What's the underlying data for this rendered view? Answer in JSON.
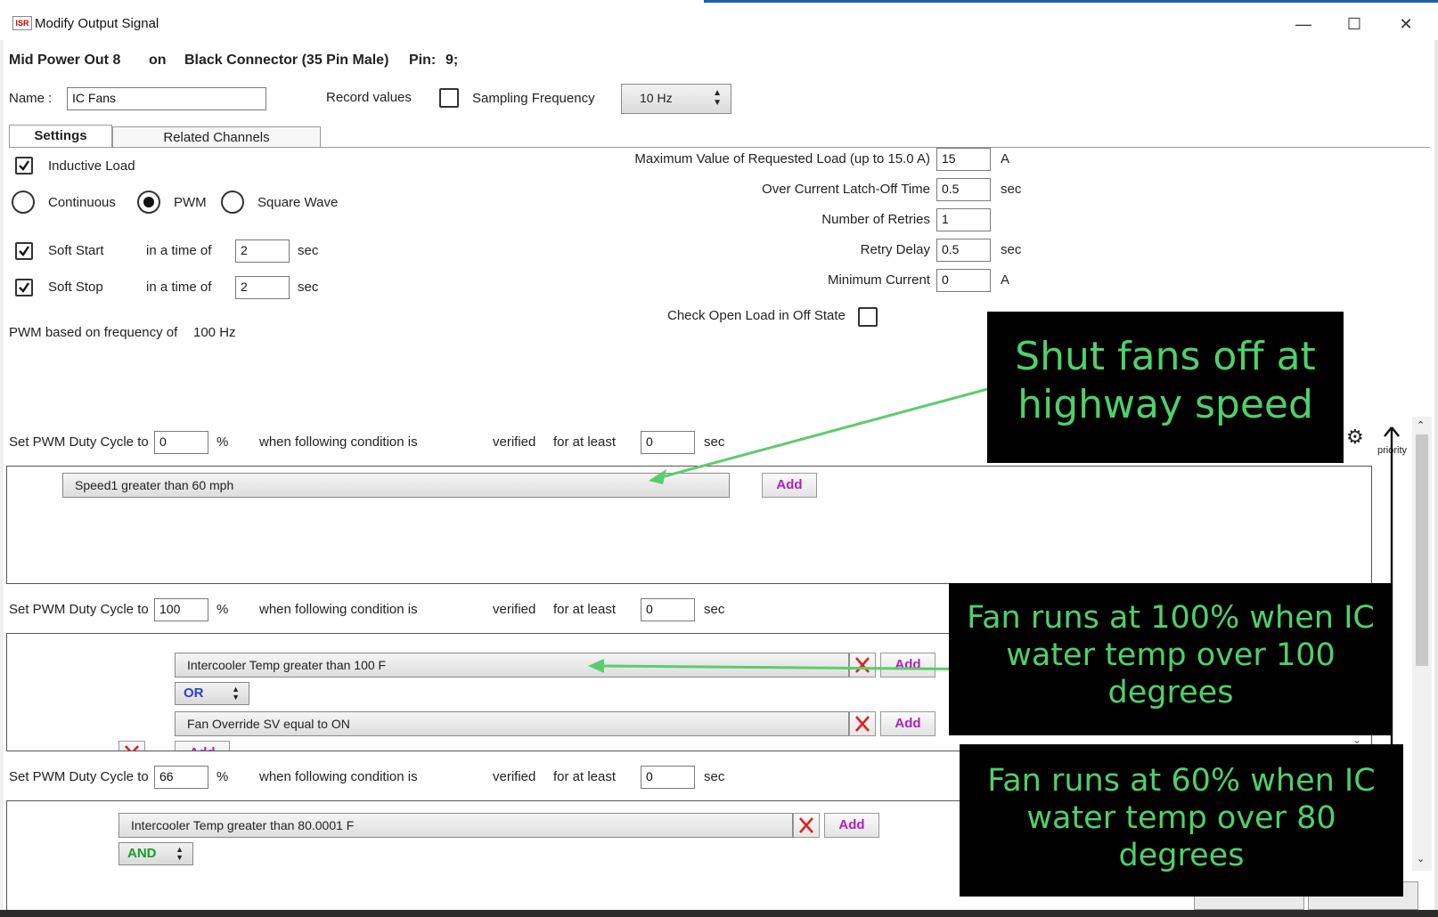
{
  "window": {
    "title": "Modify Output Signal",
    "minimize_glyph": "—",
    "maximize_glyph": "☐",
    "close_glyph": "✕"
  },
  "header": {
    "output_name": "Mid  Power Out 8",
    "on": "on",
    "connector": "Black Connector (35 Pin Male)",
    "pin_label": "Pin:",
    "pin_value": "9;"
  },
  "name_row": {
    "name_label": "Name :",
    "name_value": "IC Fans",
    "record_label": "Record values",
    "record_checked": false,
    "sampling_label": "Sampling Frequency",
    "sampling_value": "10 Hz"
  },
  "tabs": [
    {
      "label": "Settings",
      "active": true
    },
    {
      "label": "Related Channels",
      "active": false
    }
  ],
  "settings": {
    "inductive_load_label": "Inductive Load",
    "inductive_load_checked": true,
    "mode_options": [
      "Continuous",
      "PWM",
      "Square Wave"
    ],
    "mode_selected": "PWM",
    "soft_start_label": "Soft Start",
    "soft_start_checked": true,
    "soft_start_time_label": "in a time of",
    "soft_start_value": "2",
    "soft_start_unit": "sec",
    "soft_stop_label": "Soft Stop",
    "soft_stop_checked": true,
    "soft_stop_time_label": "in a time of",
    "soft_stop_value": "2",
    "soft_stop_unit": "sec",
    "pwm_freq_label": "PWM based on frequency of",
    "pwm_freq_value": "100 Hz"
  },
  "limits": {
    "max_load_label": "Maximum Value of Requested Load  (up to 15.0 A)",
    "max_load_value": "15",
    "max_load_unit": "A",
    "latch_label": "Over Current Latch-Off Time",
    "latch_value": "0.5",
    "latch_unit": "sec",
    "retries_label": "Number of Retries",
    "retries_value": "1",
    "retry_delay_label": "Retry Delay",
    "retry_delay_value": "0.5",
    "retry_delay_unit": "sec",
    "min_current_label": "Minimum Current",
    "min_current_value": "0",
    "min_current_unit": "A",
    "open_load_label": "Check Open Load in Off State",
    "open_load_checked": false
  },
  "rule_labels": {
    "set_label": "Set PWM Duty Cycle to",
    "percent": "%",
    "when_label": "when following condition is",
    "verified": "verified",
    "for_at_least": "for at least",
    "sec": "sec",
    "add": "Add",
    "priority": "priority"
  },
  "rules": [
    {
      "duty": "0",
      "time": "0",
      "conditions": [
        "Speed1   greater than   60 mph"
      ]
    },
    {
      "duty": "100",
      "time": "0",
      "conditions": [
        "Intercooler Temp   greater than   100 F",
        "Fan Override SV   equal to   ON"
      ],
      "operator": "OR"
    },
    {
      "duty": "66",
      "time": "0",
      "conditions": [
        "Intercooler Temp   greater than   80.0001 F"
      ],
      "operator": "AND"
    }
  ],
  "callouts": [
    {
      "lines": [
        "Shut fans off at",
        "highway speed"
      ]
    },
    {
      "lines": [
        "Fan runs at 100% when IC",
        "water temp over 100",
        "degrees"
      ]
    },
    {
      "lines": [
        "Fan runs at 60% when IC",
        "water temp over 80",
        "degrees"
      ]
    }
  ],
  "colors": {
    "callout_bg": "#000000",
    "callout_text": "#4fd06a",
    "arrow": "#5ccc6c",
    "add_text": "#b020c0",
    "or_text": "#2a3fd0",
    "and_text": "#1a9a2a",
    "delete_x": "#e02020"
  }
}
